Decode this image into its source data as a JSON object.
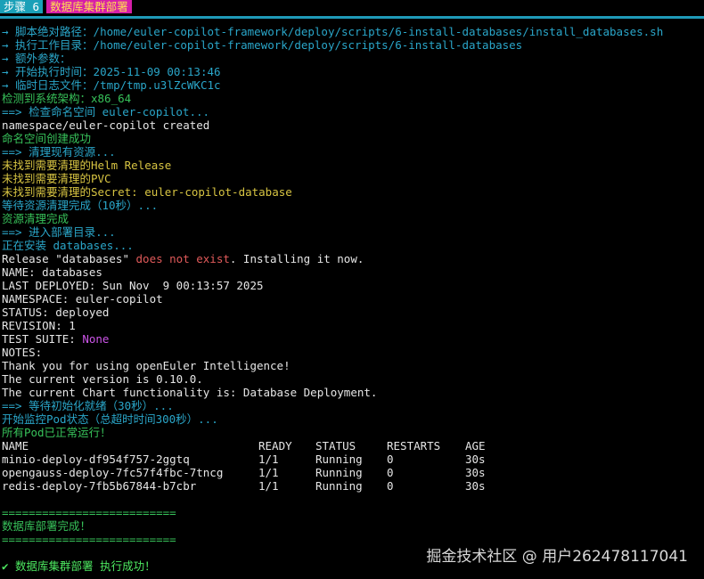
{
  "header": {
    "step_label": "步骤 6",
    "title": "数据库集群部署"
  },
  "colors": {
    "cyan": "#2aa6c9",
    "green": "#37c25a",
    "yellow": "#d7c442",
    "red": "#e05a5a",
    "magenta": "#cc55e8",
    "tab_step_bg": "#1aa0b8",
    "tab_title_bg": "#d61ea8"
  },
  "log": {
    "script_path": "→ 脚本绝对路径：/home/euler-copilot-framework/deploy/scripts/6-install-databases/install_databases.sh",
    "work_dir": "→ 执行工作目录：/home/euler-copilot-framework/deploy/scripts/6-install-databases",
    "extra_params": "→ 额外参数：",
    "start_time": "→ 开始执行时间：2025-11-09 00:13:46",
    "temp_log": "→ 临时日志文件：/tmp/tmp.u3lZcWKC1c",
    "arch_detected": "检测到系统架构：x86_64",
    "check_ns": "==> 检查命名空间 euler-copilot...",
    "ns_created_raw": "namespace/euler-copilot created",
    "ns_created": "命名空间创建成功",
    "clean_resources": "==> 清理现有资源...",
    "no_helm": "未找到需要清理的Helm Release",
    "no_pvc": "未找到需要清理的PVC",
    "no_secret": "未找到需要清理的Secret: euler-copilot-database",
    "wait_clean": "等待资源清理完成（10秒）...",
    "clean_done": "资源清理完成",
    "enter_dir": "==> 进入部署目录...",
    "installing": "正在安装 databases...",
    "release_prefix": "Release \"databases\" ",
    "release_missing": "does not exist",
    "release_suffix": ". Installing it now.",
    "name": "NAME: databases",
    "last_deployed": "LAST DEPLOYED: Sun Nov  9 00:13:57 2025",
    "namespace": "NAMESPACE: euler-copilot",
    "status": "STATUS: deployed",
    "revision": "REVISION: 1",
    "test_suite_label": "TEST SUITE: ",
    "test_suite_value": "None",
    "notes": "NOTES:",
    "thanks": "Thank you for using openEuler Intelligence!",
    "version": "The current version is 0.10.0.",
    "chart_func": "The current Chart functionality is: Database Deployment.",
    "wait_init": "==> 等待初始化就绪（30秒）...",
    "monitor": "开始监控Pod状态（总超时时间300秒）...",
    "all_running": "所有Pod已正常运行！",
    "separator": "==========================",
    "deploy_done": "数据库部署完成！",
    "final": "✔ 数据库集群部署 执行成功！"
  },
  "pods": {
    "headers": [
      "NAME",
      "READY",
      "STATUS",
      "RESTARTS",
      "AGE"
    ],
    "rows": [
      [
        "minio-deploy-df954f757-2ggtq",
        "1/1",
        "Running",
        "0",
        "30s"
      ],
      [
        "opengauss-deploy-7fc57f4fbc-7tncg",
        "1/1",
        "Running",
        "0",
        "30s"
      ],
      [
        "redis-deploy-7fb5b67844-b7cbr",
        "1/1",
        "Running",
        "0",
        "30s"
      ]
    ]
  },
  "watermark": "掘金技术社区 @ 用户262478117041"
}
